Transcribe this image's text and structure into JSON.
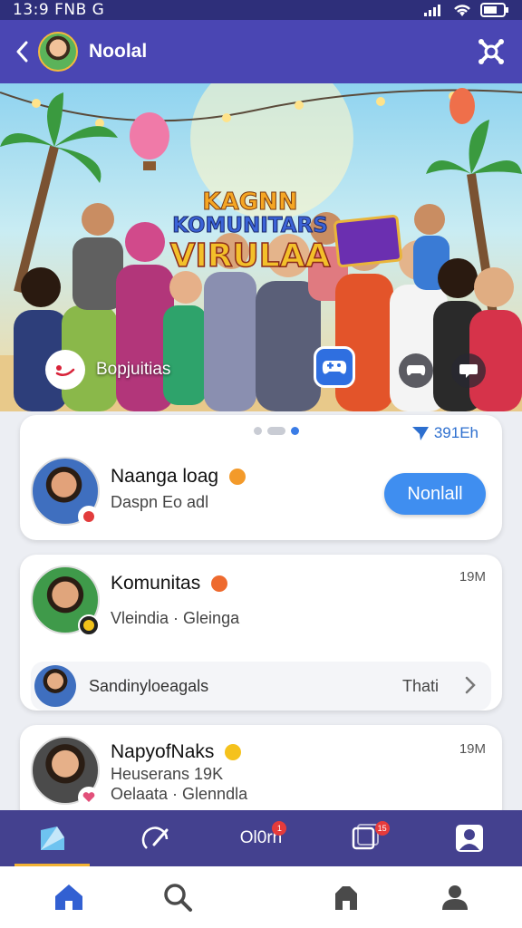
{
  "status_bar": {
    "time": "13:9 FNB G"
  },
  "header": {
    "title": "Noolal"
  },
  "hero": {
    "title_line1": "KAGNN",
    "title_line2": "KOMUNITARS",
    "title_line3": "VIRULAA",
    "chip_label": "Bopjuitias"
  },
  "carousel": {
    "stat": "391Eh"
  },
  "cards": [
    {
      "name": "Naanga loag",
      "subtitle": "Daspn Eo adl",
      "action_label": "Nonlall"
    },
    {
      "name": "Komunitas",
      "subtitle": "Vleindia · Gleinga",
      "time": "19M",
      "sub_row": {
        "label": "Sandinyloeagals",
        "action": "Thati"
      }
    },
    {
      "name": "NapyofNaks",
      "subtitle_line1": "Heuserans 19K",
      "subtitle_line2": "Oelaata · Glenndla",
      "time": "19M"
    }
  ],
  "tab_bar": {
    "center_label": "Ol0rn",
    "notif_center": "1",
    "notif_right": "15"
  },
  "colors": {
    "header": "#4a46b3",
    "accent": "#3f8ef0",
    "tab_bar": "#44418f",
    "tab_active": "#f2b233",
    "nav_icon": "#3260d2"
  },
  "icons": [
    "back-chevron-icon",
    "settings-icon",
    "home-icon",
    "search-icon",
    "edit-icon",
    "chat-icon",
    "profile-icon",
    "shop-icon",
    "send-icon"
  ]
}
